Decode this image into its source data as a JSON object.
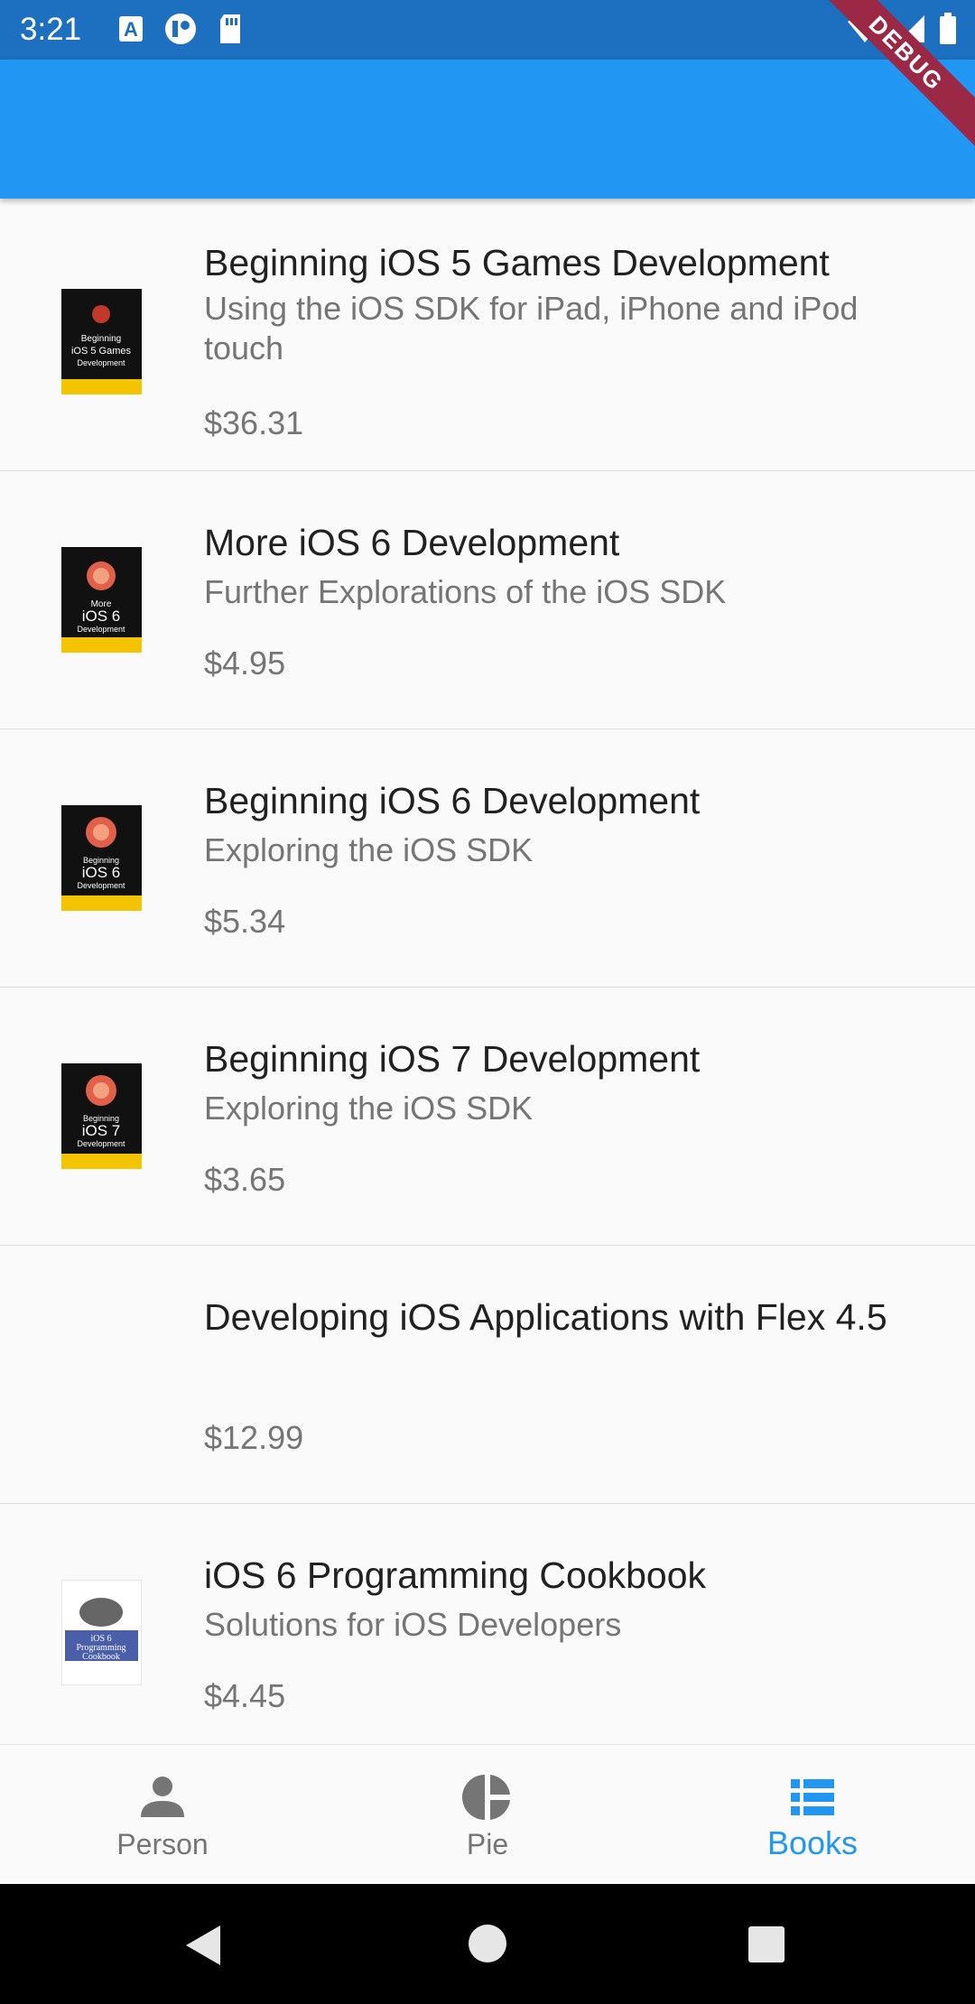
{
  "status_bar": {
    "time": "3:21",
    "left_icons": [
      "a-badge-icon",
      "circle-app-icon",
      "sd-card-icon"
    ],
    "right_icons": [
      "wifi-icon",
      "signal-icon",
      "battery-icon"
    ]
  },
  "debug_banner": "DEBUG",
  "colors": {
    "app_bar": "#2196f3",
    "status_bar": "#1d6fbf",
    "active_tab": "#2196f3",
    "inactive_tab": "#757575",
    "debug_banner": "#9b2946"
  },
  "books": [
    {
      "title": "Beginning iOS 5 Games Development",
      "subtitle": "Using the iOS SDK for iPad, iPhone and iPod touch",
      "price": "$36.31",
      "cover_icon": "book-cover-ios5-games"
    },
    {
      "title": "More iOS 6 Development",
      "subtitle": "Further Explorations of the iOS SDK",
      "price": "$4.95",
      "cover_icon": "book-cover-more-ios6"
    },
    {
      "title": "Beginning iOS 6 Development",
      "subtitle": "Exploring the iOS SDK",
      "price": "$5.34",
      "cover_icon": "book-cover-beginning-ios6"
    },
    {
      "title": "Beginning iOS 7 Development",
      "subtitle": "Exploring the iOS SDK",
      "price": "$3.65",
      "cover_icon": "book-cover-beginning-ios7"
    },
    {
      "title": "Developing iOS Applications with Flex 4.5",
      "subtitle": "",
      "price": "$12.99",
      "cover_icon": ""
    },
    {
      "title": "iOS 6 Programming Cookbook",
      "subtitle": "Solutions for iOS Developers",
      "price": "$4.45",
      "cover_icon": "book-cover-ios6-cookbook"
    }
  ],
  "bottom_nav": {
    "items": [
      {
        "label": "Person",
        "icon": "person-icon",
        "active": false
      },
      {
        "label": "Pie",
        "icon": "pie-chart-icon",
        "active": false
      },
      {
        "label": "Books",
        "icon": "list-icon",
        "active": true
      }
    ]
  },
  "system_nav": [
    "back-icon",
    "home-icon",
    "recents-icon"
  ]
}
